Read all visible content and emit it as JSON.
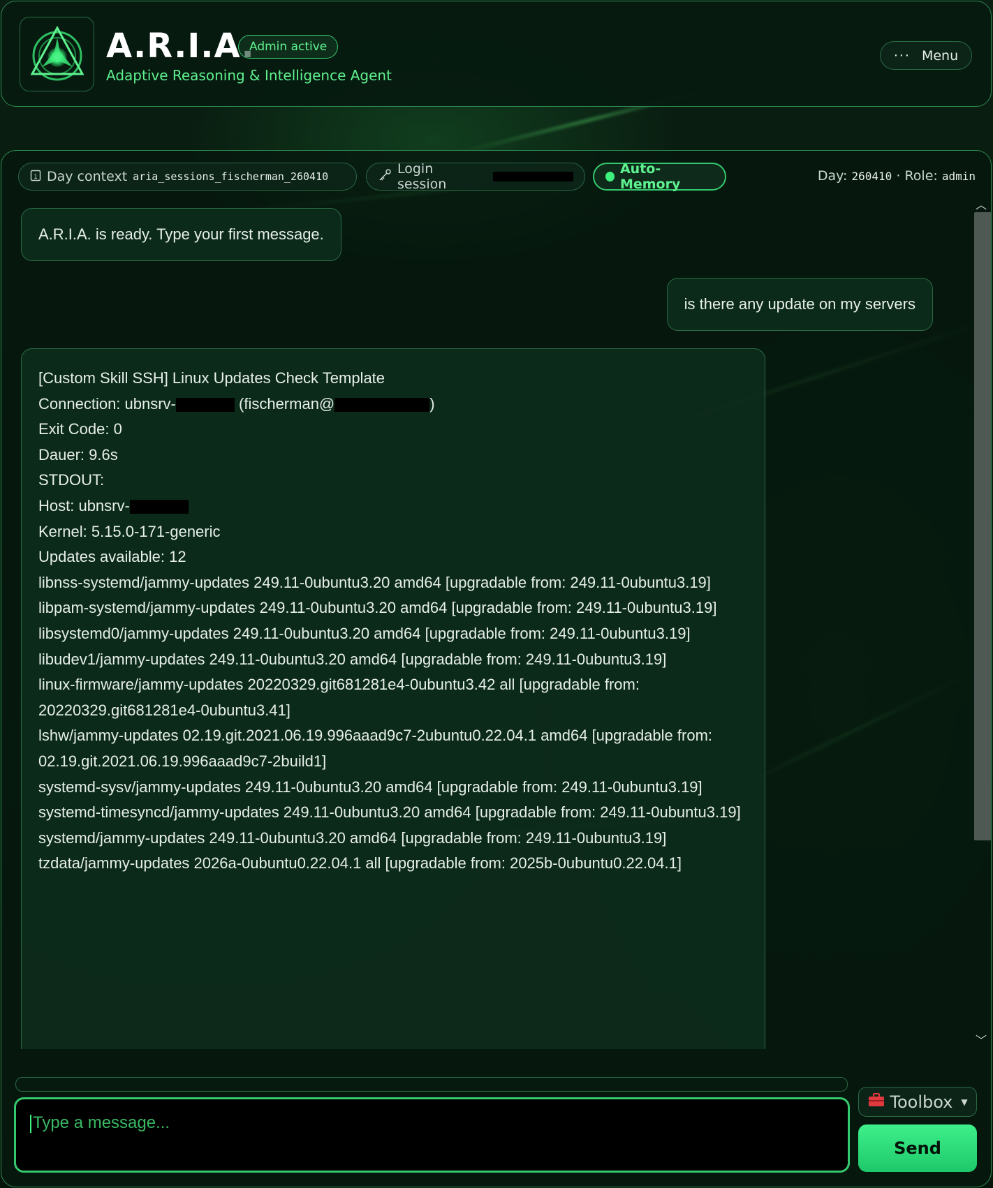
{
  "header": {
    "title": "A.R.I.A.",
    "badge": "Admin active",
    "subtitle": "Adaptive Reasoning & Intelligence Agent",
    "menu_icon": "ellipsis-icon",
    "menu_label": "Menu"
  },
  "context_bar": {
    "day_context_label": "Day context",
    "day_context_value": "aria_sessions_fischerman_260410",
    "login_session_label": "Login session",
    "auto_memory_label": "Auto-Memory",
    "day_label": "Day:",
    "day_value": "260410",
    "separator": "·",
    "role_label": "Role:",
    "role_value": "admin"
  },
  "messages": [
    {
      "role": "assistant",
      "text": "A.R.I.A. is ready. Type your first message."
    },
    {
      "role": "user",
      "text": "is there any update on my servers"
    }
  ],
  "ssh_result": {
    "line1": "[Custom Skill SSH] Linux Updates Check Template",
    "conn_prefix": "Connection: ubnsrv-",
    "conn_user": " (fischerman@",
    "conn_close": ")",
    "exit_code": "Exit Code: 0",
    "dauer": "Dauer: 9.6s",
    "stdout": "STDOUT:",
    "host_prefix": "Host: ubnsrv-",
    "kernel": "Kernel: 5.15.0-171-generic",
    "updates": "Updates available: 12",
    "packages": "libnss-systemd/jammy-updates 249.11-0ubuntu3.20 amd64 [upgradable from: 249.11-0ubuntu3.19]\nlibpam-systemd/jammy-updates 249.11-0ubuntu3.20 amd64 [upgradable from: 249.11-0ubuntu3.19]\nlibsystemd0/jammy-updates 249.11-0ubuntu3.20 amd64 [upgradable from: 249.11-0ubuntu3.19]\nlibudev1/jammy-updates 249.11-0ubuntu3.20 amd64 [upgradable from: 249.11-0ubuntu3.19]\nlinux-firmware/jammy-updates 20220329.git681281e4-0ubuntu3.42 all [upgradable from: 20220329.git681281e4-0ubuntu3.41]\nlshw/jammy-updates 02.19.git.2021.06.19.996aaad9c7-2ubuntu0.22.04.1 amd64 [upgradable from: 02.19.git.2021.06.19.996aaad9c7-2build1]\nsystemd-sysv/jammy-updates 249.11-0ubuntu3.20 amd64 [upgradable from: 249.11-0ubuntu3.19]\nsystemd-timesyncd/jammy-updates 249.11-0ubuntu3.20 amd64 [upgradable from: 249.11-0ubuntu3.19]\nsystemd/jammy-updates 249.11-0ubuntu3.20 amd64 [upgradable from: 249.11-0ubuntu3.19]\ntzdata/jammy-updates 2026a-0ubuntu0.22.04.1 all [upgradable from: 2025b-0ubuntu0.22.04.1]"
  },
  "composer": {
    "placeholder": "Type a message...",
    "toolbox_label": "Toolbox",
    "toolbox_icon": "toolbox-icon",
    "dropdown_icon": "caret-down-icon",
    "send_label": "Send"
  },
  "colors": {
    "accent": "#35c96f",
    "accent_text": "#5ff28f",
    "panel_bg": "#0e2c1d",
    "send_bg": "#2ee07a"
  }
}
